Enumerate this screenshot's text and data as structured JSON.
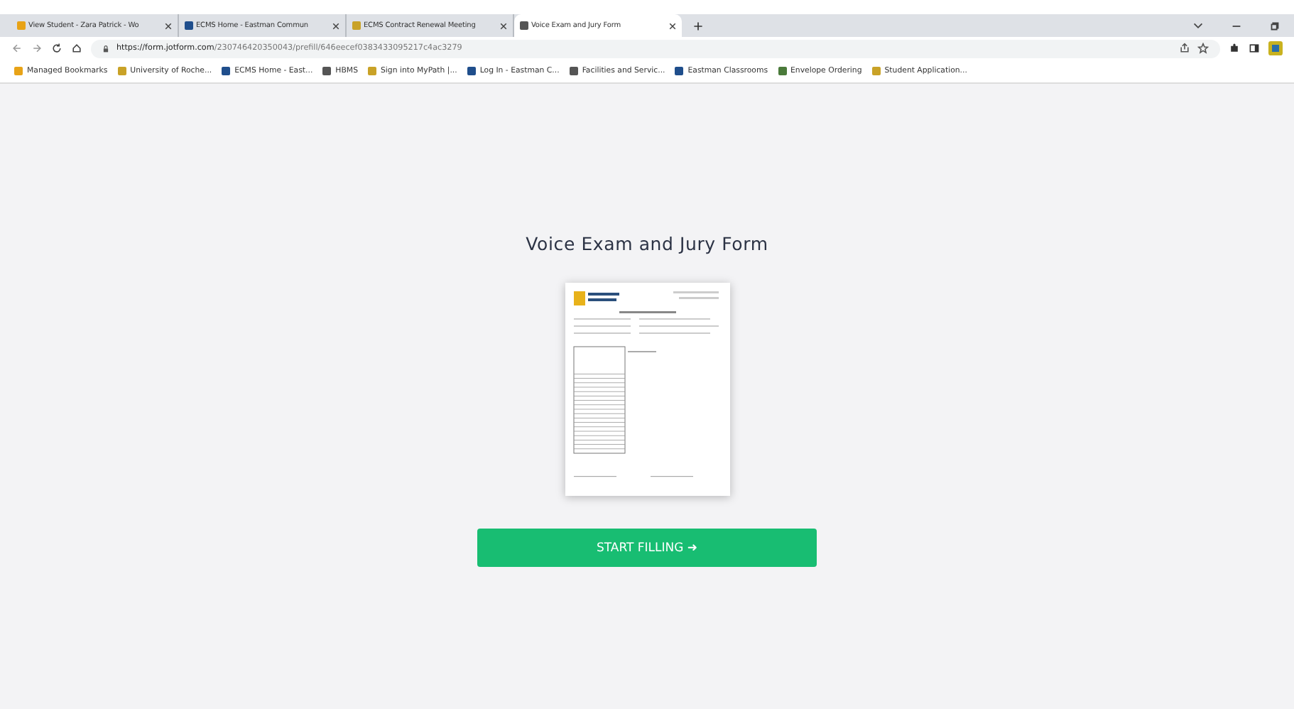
{
  "tabs": [
    {
      "title": "View Student - Zara Patrick - Wo",
      "selected": false
    },
    {
      "title": "ECMS Home - Eastman Commun",
      "selected": false
    },
    {
      "title": "ECMS Contract Renewal Meeting",
      "selected": false
    },
    {
      "title": "Voice Exam and Jury Form",
      "selected": true
    }
  ],
  "address": {
    "host": "https://form.jotform.com",
    "path": "/230746420350043/prefill/646eecef0383433095217c4ac3279"
  },
  "bookmarks": [
    "Managed Bookmarks",
    "University of Roche...",
    "ECMS Home - East...",
    "HBMS",
    "Sign into MyPath |...",
    "Log In - Eastman C...",
    "Facilities and Servic...",
    "Eastman Classrooms",
    "Envelope Ordering",
    "Student Application..."
  ],
  "form": {
    "title": "Voice Exam and Jury Form",
    "button": "START FILLING ➜"
  }
}
